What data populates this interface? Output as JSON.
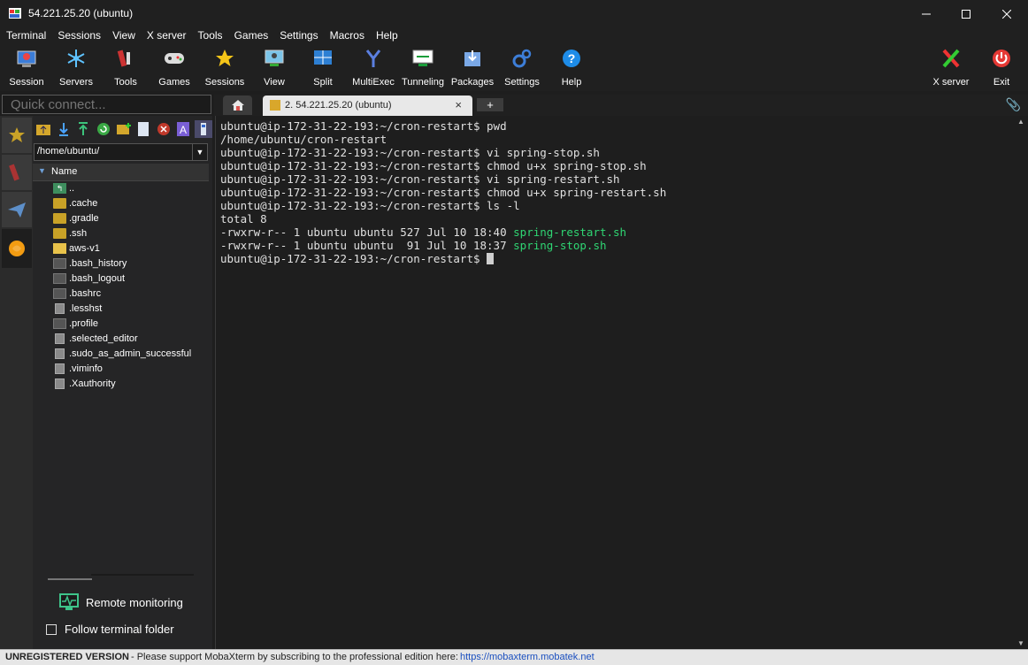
{
  "window": {
    "title": "54.221.25.20 (ubuntu)"
  },
  "menu": [
    "Terminal",
    "Sessions",
    "View",
    "X server",
    "Tools",
    "Games",
    "Settings",
    "Macros",
    "Help"
  ],
  "toolbar": {
    "items": [
      {
        "label": "Session",
        "icon": "session-icon"
      },
      {
        "label": "Servers",
        "icon": "servers-icon"
      },
      {
        "label": "Tools",
        "icon": "tools-icon"
      },
      {
        "label": "Games",
        "icon": "games-icon"
      },
      {
        "label": "Sessions",
        "icon": "star-icon"
      },
      {
        "label": "View",
        "icon": "view-icon"
      },
      {
        "label": "Split",
        "icon": "split-icon"
      },
      {
        "label": "MultiExec",
        "icon": "multiexec-icon"
      },
      {
        "label": "Tunneling",
        "icon": "tunneling-icon"
      },
      {
        "label": "Packages",
        "icon": "packages-icon"
      },
      {
        "label": "Settings",
        "icon": "settings-icon"
      },
      {
        "label": "Help",
        "icon": "help-icon"
      }
    ],
    "xserver_label": "X server",
    "exit_label": "Exit"
  },
  "quick_connect": {
    "placeholder": "Quick connect..."
  },
  "sftp": {
    "path": "/home/ubuntu/",
    "column_name": "Name",
    "files": [
      {
        "name": "..",
        "type": "up"
      },
      {
        "name": ".cache",
        "type": "folder"
      },
      {
        "name": ".gradle",
        "type": "folder"
      },
      {
        "name": ".ssh",
        "type": "folder"
      },
      {
        "name": "aws-v1",
        "type": "folder-open"
      },
      {
        "name": ".bash_history",
        "type": "file-dark"
      },
      {
        "name": ".bash_logout",
        "type": "file-dark"
      },
      {
        "name": ".bashrc",
        "type": "file-dark"
      },
      {
        "name": ".lesshst",
        "type": "file-light"
      },
      {
        "name": ".profile",
        "type": "file-dark"
      },
      {
        "name": ".selected_editor",
        "type": "file-light"
      },
      {
        "name": ".sudo_as_admin_successful",
        "type": "file-light"
      },
      {
        "name": ".viminfo",
        "type": "file-light"
      },
      {
        "name": ".Xauthority",
        "type": "file-light"
      }
    ],
    "remote_monitoring": "Remote monitoring",
    "follow_folder": "Follow terminal folder"
  },
  "tabs": {
    "session_tab": "2. 54.221.25.20 (ubuntu)",
    "close": "×",
    "add": "+"
  },
  "terminal": {
    "lines": [
      "ubuntu@ip-172-31-22-193:~/cron-restart$ pwd",
      "/home/ubuntu/cron-restart",
      "ubuntu@ip-172-31-22-193:~/cron-restart$ vi spring-stop.sh",
      "ubuntu@ip-172-31-22-193:~/cron-restart$ chmod u+x spring-stop.sh",
      "ubuntu@ip-172-31-22-193:~/cron-restart$ vi spring-restart.sh",
      "ubuntu@ip-172-31-22-193:~/cron-restart$ chmod u+x spring-restart.sh",
      "ubuntu@ip-172-31-22-193:~/cron-restart$ ls -l",
      "total 8"
    ],
    "ls_rows": [
      {
        "meta": "-rwxrw-r-- 1 ubuntu ubuntu 527 Jul 10 18:40 ",
        "file": "spring-restart.sh"
      },
      {
        "meta": "-rwxrw-r-- 1 ubuntu ubuntu  91 Jul 10 18:37 ",
        "file": "spring-stop.sh"
      }
    ],
    "prompt": "ubuntu@ip-172-31-22-193:~/cron-restart$ "
  },
  "status": {
    "unregistered": "UNREGISTERED VERSION",
    "message": "-  Please support MobaXterm by subscribing to the professional edition here:",
    "link": "https://mobaxterm.mobatek.net"
  },
  "colors": {
    "accent_green": "#2fd673",
    "link": "#1a4fbf"
  }
}
